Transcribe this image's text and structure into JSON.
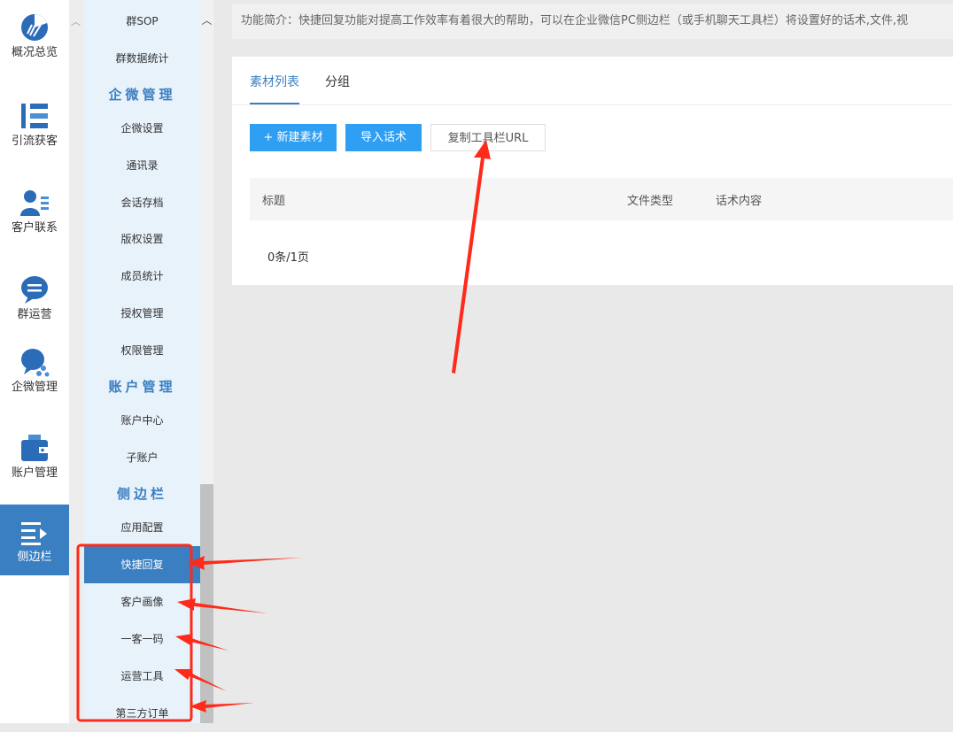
{
  "rail": {
    "items": [
      {
        "label": "概况总览",
        "icon": "pie-chart-icon"
      },
      {
        "label": "引流获客",
        "icon": "tree-structure-icon"
      },
      {
        "label": "客户联系",
        "icon": "contacts-icon"
      },
      {
        "label": "群运营",
        "icon": "chat-bubble-icon"
      },
      {
        "label": "企微管理",
        "icon": "chat-network-icon"
      },
      {
        "label": "账户管理",
        "icon": "wallet-icon"
      },
      {
        "label": "侧边栏",
        "icon": "sidebar-list-icon"
      }
    ]
  },
  "submenu": {
    "items_top": [
      "群SOP",
      "群数据统计"
    ],
    "section_qiwei": "企微管理",
    "items_qiwei": [
      "企微设置",
      "通讯录",
      "会话存档",
      "版权设置",
      "成员统计",
      "授权管理",
      "权限管理"
    ],
    "section_account": "账户管理",
    "items_account": [
      "账户中心",
      "子账户"
    ],
    "section_sidebar": "侧边栏",
    "items_sidebar": [
      "应用配置",
      "快捷回复",
      "客户画像",
      "一客一码",
      "运营工具",
      "第三方订单"
    ]
  },
  "notice": "功能简介：快捷回复功能对提高工作效率有着很大的帮助，可以在企业微信PC侧边栏（或手机聊天工具栏）将设置好的话术,文件,视",
  "tabs": [
    "素材列表",
    "分组"
  ],
  "buttons": {
    "new_material": "+ 新建素材",
    "import_script": "导入话术",
    "copy_url": "复制工具栏URL"
  },
  "table": {
    "headers": [
      "标题",
      "文件类型",
      "话术内容"
    ]
  },
  "pager": "0条/1页",
  "colors": {
    "accent": "#3a7fc1",
    "button": "#2e9ff3",
    "annotation": "#ff2a1a"
  }
}
